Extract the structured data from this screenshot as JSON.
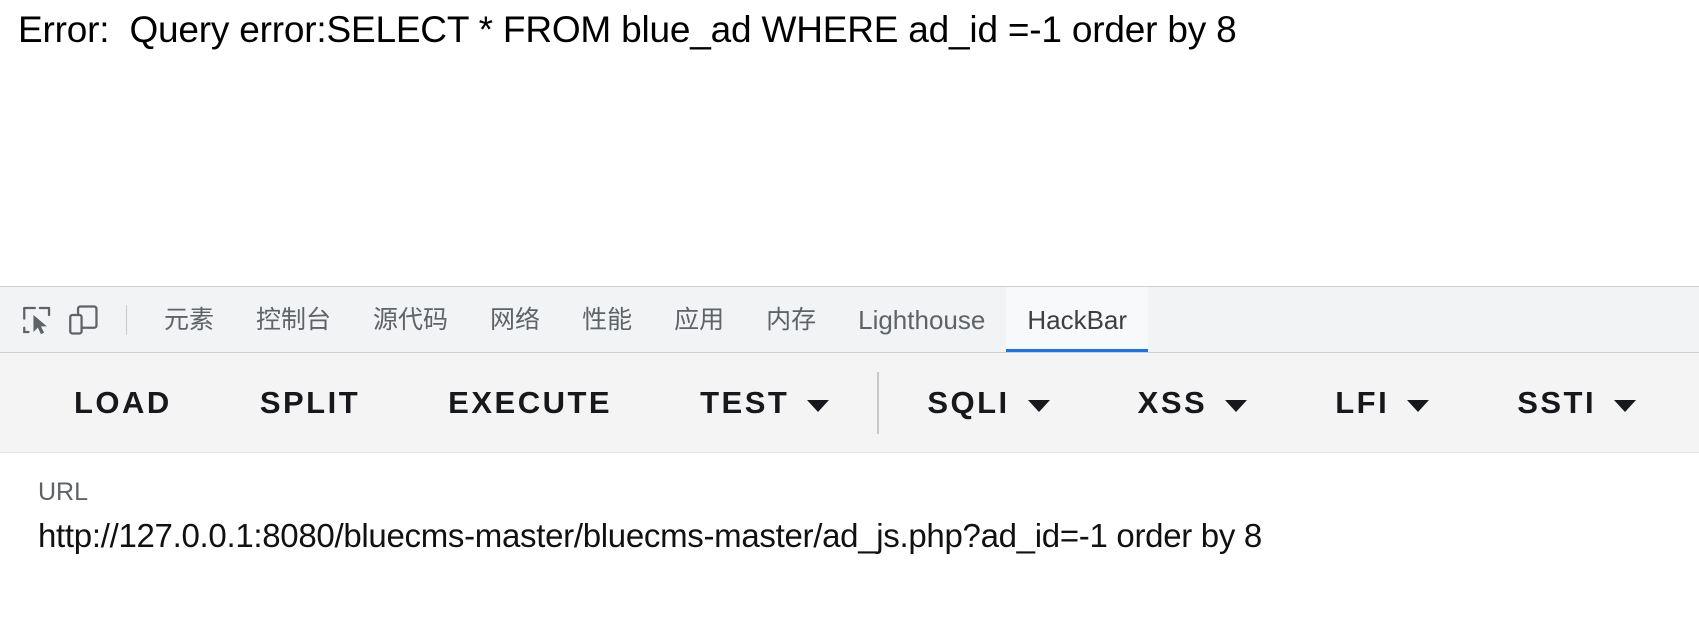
{
  "page": {
    "error_text": "Error:  Query error:SELECT * FROM blue_ad WHERE ad_id =-1 order by 8"
  },
  "devtools": {
    "icons": [
      {
        "name": "inspect-element-icon",
        "label": "inspect-element"
      },
      {
        "name": "device-toolbar-icon",
        "label": "toggle-device-toolbar"
      }
    ],
    "tabs": [
      {
        "label": "元素",
        "cjk": true,
        "active": false
      },
      {
        "label": "控制台",
        "cjk": true,
        "active": false
      },
      {
        "label": "源代码",
        "cjk": true,
        "active": false
      },
      {
        "label": "网络",
        "cjk": true,
        "active": false
      },
      {
        "label": "性能",
        "cjk": true,
        "active": false
      },
      {
        "label": "应用",
        "cjk": true,
        "active": false
      },
      {
        "label": "内存",
        "cjk": true,
        "active": false
      },
      {
        "label": "Lighthouse",
        "cjk": false,
        "active": false
      },
      {
        "label": "HackBar",
        "cjk": false,
        "active": true
      }
    ],
    "active_tab_color": "#1a73e8"
  },
  "hackbar": {
    "buttons": [
      {
        "label": "LOAD",
        "caret": false
      },
      {
        "label": "SPLIT",
        "caret": false
      },
      {
        "label": "EXECUTE",
        "caret": false
      },
      {
        "label": "TEST",
        "caret": true
      },
      {
        "label": "SQLI",
        "caret": true
      },
      {
        "label": "XSS",
        "caret": true
      },
      {
        "label": "LFI",
        "caret": true
      },
      {
        "label": "SSTI",
        "caret": true
      }
    ],
    "url": {
      "label": "URL",
      "value": "http://127.0.0.1:8080/bluecms-master/bluecms-master/ad_js.php?ad_id=-1 order by 8",
      "placeholder": "URL"
    }
  }
}
